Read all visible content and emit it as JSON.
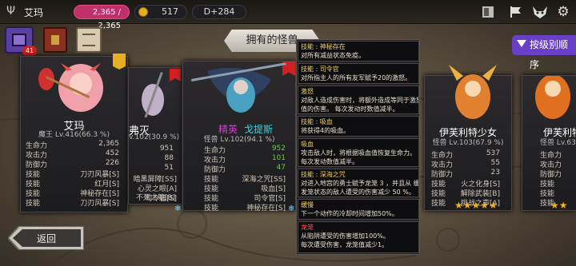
{
  "topbar": {
    "player_name": "艾玛",
    "hp": "2,365 / 2,365",
    "gold": "517",
    "day": "D+284"
  },
  "left_icons": {
    "badge": "41"
  },
  "header": {
    "title": "拥有的怪兽"
  },
  "sort_button": {
    "label": "按级别顺序"
  },
  "back_button": {
    "label": "返回"
  },
  "stat_labels": [
    "生命力",
    "攻击力",
    "防御力",
    "技能",
    "技能",
    "技能"
  ],
  "cards": [
    {
      "name": "艾玛",
      "level": "魔王 Lv.416(66.3 %)",
      "stats": [
        "2,365",
        "452",
        "226"
      ],
      "skills": [
        "刀刃风暴[S]",
        "红月[S]",
        "神秘存在[S]",
        "刀刃风暴[S]"
      ],
      "skill_labels": [
        "技能",
        "技能",
        "技能",
        "技能"
      ]
    },
    {
      "name": "弗灭",
      "level": "v.102(30.9 %)",
      "stats": [
        "951",
        "88",
        "51"
      ],
      "skills": [
        "暗黑屏障[SS]",
        "心灵之眼[A]",
        "司令官[S]",
        "不死之躯[B]"
      ]
    },
    {
      "name": "精英 戈提斯",
      "name_prefix": "精英",
      "name_main": "戈提斯",
      "level": "怪兽 Lv.102(94.1 %)",
      "stats": [
        "952",
        "101",
        "47"
      ],
      "skills": [
        "深海之咒[SS]",
        "吸血[S]",
        "司令官[S]",
        "神秘存在[S]"
      ]
    },
    {
      "name": "伊芙利特少女",
      "level": "怪兽 Lv.103(67.9 %)",
      "stats": [
        "537",
        "55",
        "23"
      ],
      "skills": [
        "火之化身[S]",
        "解除武装[B]",
        "挑战之声[A]"
      ]
    },
    {
      "name": "伊芙利特",
      "level": "怪兽 Lv.63(5",
      "stats": [],
      "skills": []
    }
  ],
  "card_short_labels": {
    "hp": "生命力",
    "atk": "攻击力",
    "def": "防御力",
    "skill": "技能"
  },
  "tooltip": [
    {
      "title": "技能 : 神秘存在",
      "lines": [
        "对所有减益状态免疫。"
      ]
    },
    {
      "title": "技能 : 司令官",
      "lines": [
        "对所指主人的所有友军赋予20的激怒。"
      ]
    },
    {
      "title": "激怒",
      "lines": [
        "对敌人造成伤害时，将额外造成等同于激怒数",
        "值的伤害。 每次发动时数值减半。"
      ]
    },
    {
      "title": "技能 : 吸血",
      "lines": [
        "将获得4的吸血。"
      ]
    },
    {
      "title": "吸血",
      "lines": [
        "攻击敌人时，将根据吸血值恢复生命力。",
        "每次发动数值减半。"
      ]
    },
    {
      "title": "技能 : 深海之咒",
      "lines": [
        "对进入地宫的勇士赋予龙笼 3 ，并且从 缓慢",
        "发笼状态的敌人遭受的伤害减少 50 %。"
      ]
    },
    {
      "title": "缓慢",
      "lines": [
        "下一个动作的冷却时间增加50%。"
      ]
    },
    {
      "title": "龙笼",
      "lines": [
        "从陷阱遭受的伤害增加100%。",
        "每次遭受伤害，龙笼值减少1。"
      ]
    }
  ],
  "colors": {
    "accent_purple": "#6a3fc8",
    "hp_pink": "#c0306a",
    "green_stat": "#6cd040",
    "elite_cyan": "#40d0e0"
  }
}
